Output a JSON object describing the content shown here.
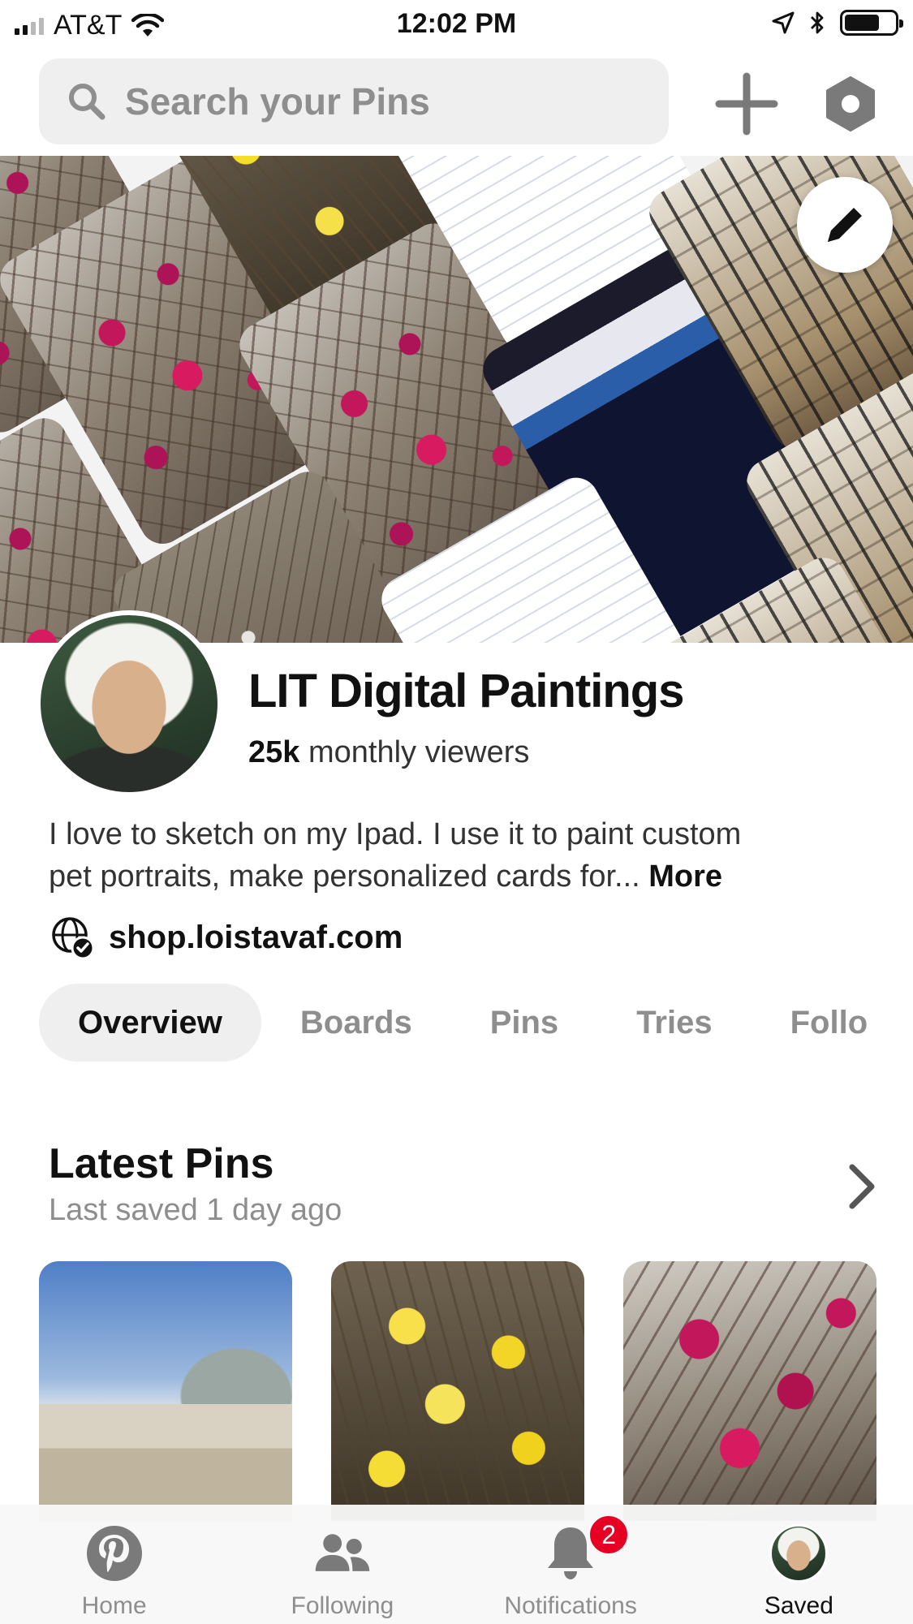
{
  "status_bar": {
    "carrier": "AT&T",
    "time": "12:02 PM",
    "icons": [
      "signal-icon",
      "wifi-icon",
      "location-arrow-icon",
      "bluetooth-icon",
      "battery-icon"
    ]
  },
  "top_bar": {
    "search_placeholder": "Search your Pins",
    "icons": [
      "search-icon",
      "plus-icon",
      "settings-hexagon-icon"
    ]
  },
  "cover": {
    "edit_icon": "pencil-icon"
  },
  "profile": {
    "name": "LIT Digital Paintings",
    "viewers_count": "25k",
    "viewers_label": "monthly viewers",
    "bio_line1": "I love to sketch on my Ipad. I use it to paint custom",
    "bio_line2": "pet portraits, make personalized cards for...",
    "bio_more": "More",
    "website": "shop.loistavaf.com",
    "website_icon": "verified-globe-icon"
  },
  "tabs": [
    {
      "label": "Overview",
      "active": true
    },
    {
      "label": "Boards",
      "active": false
    },
    {
      "label": "Pins",
      "active": false
    },
    {
      "label": "Tries",
      "active": false
    },
    {
      "label": "Follo",
      "active": false
    }
  ],
  "latest_pins": {
    "title": "Latest Pins",
    "subtitle": "Last saved 1 day ago",
    "arrow_icon": "chevron-right-icon"
  },
  "bottom_nav": [
    {
      "label": "Home",
      "icon": "pinterest-logo-icon",
      "active": false
    },
    {
      "label": "Following",
      "icon": "people-icon",
      "active": false
    },
    {
      "label": "Notifications",
      "icon": "bell-icon",
      "active": false,
      "badge": "2"
    },
    {
      "label": "Saved",
      "icon": "profile-avatar-icon",
      "active": true
    }
  ],
  "colors": {
    "accent": "#e60023",
    "search_bg": "#efefef",
    "muted_text": "#8e8e8e"
  }
}
